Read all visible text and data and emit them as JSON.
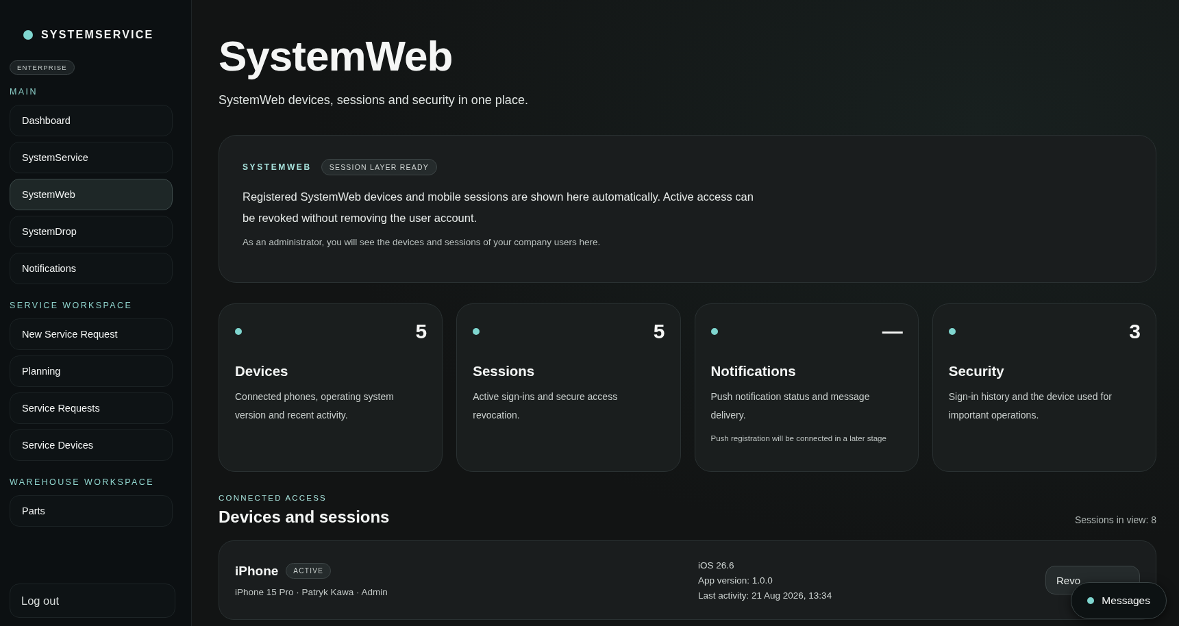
{
  "sidebar": {
    "brand": "SYSTEMSERVICE",
    "badge": "ENTERPRISE",
    "groups": [
      {
        "title": "MAIN",
        "items": [
          {
            "label": "Dashboard",
            "selected": false
          },
          {
            "label": "SystemService",
            "selected": false
          },
          {
            "label": "SystemWeb",
            "selected": true
          },
          {
            "label": "SystemDrop",
            "selected": false
          },
          {
            "label": "Notifications",
            "selected": false
          }
        ]
      },
      {
        "title": "SERVICE WORKSPACE",
        "items": [
          {
            "label": "New Service Request",
            "selected": false
          },
          {
            "label": "Planning",
            "selected": false
          },
          {
            "label": "Service Requests",
            "selected": false
          },
          {
            "label": "Service Devices",
            "selected": false
          }
        ]
      },
      {
        "title": "WAREHOUSE WORKSPACE",
        "items": [
          {
            "label": "Parts",
            "selected": false
          }
        ]
      }
    ],
    "logout": "Log out"
  },
  "header": {
    "title": "SystemWeb",
    "subtitle": "SystemWeb devices, sessions and security in one place."
  },
  "intro": {
    "eyebrow": "SYSTEMWEB",
    "badge": "SESSION LAYER READY",
    "text": "Registered SystemWeb devices and mobile sessions are shown here automatically. Active access can be revoked without removing the user account.",
    "note": "As an administrator, you will see the devices and sessions of your company users here."
  },
  "stats": [
    {
      "value": "5",
      "title": "Devices",
      "text": "Connected phones, operating system version and recent activity."
    },
    {
      "value": "5",
      "title": "Sessions",
      "text": "Active sign-ins and secure access revocation."
    },
    {
      "value": "—",
      "title": "Notifications",
      "text": "Push notification status and message delivery.",
      "note": "Push registration will be connected in a later stage"
    },
    {
      "value": "3",
      "title": "Security",
      "text": "Sign-in history and the device used for important operations."
    }
  ],
  "section": {
    "eyebrow": "CONNECTED ACCESS",
    "title": "Devices and sessions",
    "count": "Sessions in view: 8"
  },
  "sessions": [
    {
      "name": "iPhone",
      "status": "ACTIVE",
      "detail": "iPhone 15 Pro · Patryk Kawa · Admin",
      "os": "iOS 26.6",
      "app_version": "App version: 1.0.0",
      "last_activity": "Last activity: 21 Aug 2026, 13:34",
      "action": "Revo"
    }
  ],
  "messages_button": "Messages"
}
